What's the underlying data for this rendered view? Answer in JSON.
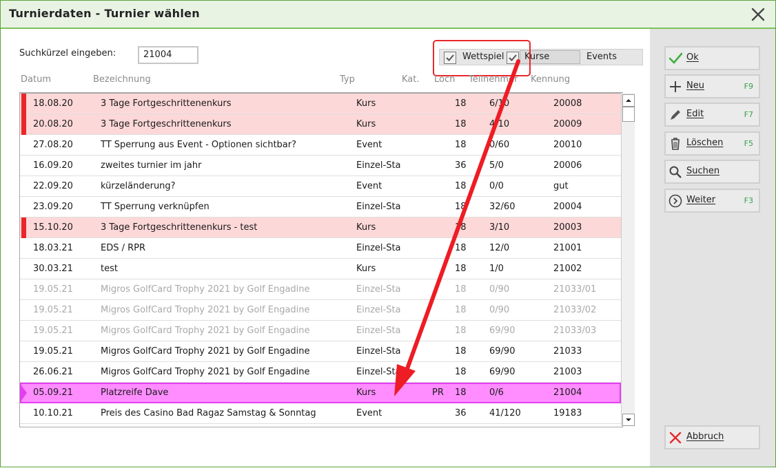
{
  "window": {
    "title": "Turnierdaten - Turnier wählen"
  },
  "search": {
    "label": "Suchkürzel eingeben:",
    "value": "21004"
  },
  "filters": [
    {
      "label": "Wettspiel",
      "checked": true
    },
    {
      "label": "Kurse",
      "checked": true
    },
    {
      "label": "Events",
      "checked": false
    }
  ],
  "columns": [
    "Datum",
    "Bezeichnung",
    "Typ",
    "Kat.",
    "Loch",
    "Teilnehmer",
    "Kennung"
  ],
  "rows": [
    {
      "datum": "18.08.20",
      "bezeichnung": "3 Tage Fortgeschrittenenkurs",
      "typ": "Kurs",
      "kat": "",
      "loch": "18",
      "teilnehmer": "6/10",
      "kennung": "20008",
      "style": "pink"
    },
    {
      "datum": "20.08.20",
      "bezeichnung": "3 Tage Fortgeschrittenenkurs",
      "typ": "Kurs",
      "kat": "",
      "loch": "18",
      "teilnehmer": "4/10",
      "kennung": "20009",
      "style": "pink"
    },
    {
      "datum": "27.08.20",
      "bezeichnung": "TT Sperrung aus Event - Optionen sichtbar?",
      "typ": "Event",
      "kat": "",
      "loch": "18",
      "teilnehmer": "0/60",
      "kennung": "20010",
      "style": "normal"
    },
    {
      "datum": "16.09.20",
      "bezeichnung": "zweites turnier im jahr",
      "typ": "Einzel-Sta",
      "kat": "",
      "loch": "36",
      "teilnehmer": "5/0",
      "kennung": "20006",
      "style": "normal"
    },
    {
      "datum": "22.09.20",
      "bezeichnung": "kürzeländerung?",
      "typ": "Event",
      "kat": "",
      "loch": "18",
      "teilnehmer": "0/0",
      "kennung": "gut",
      "style": "normal"
    },
    {
      "datum": "23.09.20",
      "bezeichnung": "TT Sperrung verknüpfen",
      "typ": "Einzel-Sta",
      "kat": "",
      "loch": "18",
      "teilnehmer": "32/60",
      "kennung": "20004",
      "style": "normal"
    },
    {
      "datum": "15.10.20",
      "bezeichnung": "3 Tage Fortgeschrittenenkurs - test",
      "typ": "Kurs",
      "kat": "",
      "loch": "18",
      "teilnehmer": "3/10",
      "kennung": "20003",
      "style": "pink"
    },
    {
      "datum": "18.03.21",
      "bezeichnung": "EDS / RPR",
      "typ": "Einzel-Sta",
      "kat": "",
      "loch": "18",
      "teilnehmer": "12/0",
      "kennung": "21001",
      "style": "normal"
    },
    {
      "datum": "30.03.21",
      "bezeichnung": "test",
      "typ": "Kurs",
      "kat": "",
      "loch": "18",
      "teilnehmer": "1/0",
      "kennung": "21002",
      "style": "normal"
    },
    {
      "datum": "19.05.21",
      "bezeichnung": "Migros GolfCard Trophy 2021 by Golf Engadine",
      "typ": "Einzel-Sta",
      "kat": "",
      "loch": "18",
      "teilnehmer": "0/90",
      "kennung": "21033/01",
      "style": "grey"
    },
    {
      "datum": "19.05.21",
      "bezeichnung": "Migros GolfCard Trophy 2021 by Golf Engadine",
      "typ": "Einzel-Sta",
      "kat": "",
      "loch": "18",
      "teilnehmer": "0/90",
      "kennung": "21033/02",
      "style": "grey"
    },
    {
      "datum": "19.05.21",
      "bezeichnung": "Migros GolfCard Trophy 2021 by Golf Engadine",
      "typ": "Einzel-Sta",
      "kat": "",
      "loch": "18",
      "teilnehmer": "69/90",
      "kennung": "21033/03",
      "style": "grey"
    },
    {
      "datum": "19.05.21",
      "bezeichnung": "Migros GolfCard Trophy 2021 by Golf Engadine",
      "typ": "Einzel-Sta",
      "kat": "",
      "loch": "18",
      "teilnehmer": "69/90",
      "kennung": "21033",
      "style": "normal"
    },
    {
      "datum": "26.06.21",
      "bezeichnung": "Migros GolfCard Trophy 2021 by Golf Engadine",
      "typ": "Einzel-Sta",
      "kat": "",
      "loch": "18",
      "teilnehmer": "69/90",
      "kennung": "21003",
      "style": "normal"
    },
    {
      "datum": "05.09.21",
      "bezeichnung": "Platzreife Dave",
      "typ": "Kurs",
      "kat": "PR",
      "loch": "18",
      "teilnehmer": "0/6",
      "kennung": "21004",
      "style": "magenta"
    },
    {
      "datum": "10.10.21",
      "bezeichnung": "Preis des Casino Bad Ragaz  Samstag & Sonntag",
      "typ": "Event",
      "kat": "",
      "loch": "36",
      "teilnehmer": "41/120",
      "kennung": "19183",
      "style": "normal"
    }
  ],
  "buttons": [
    {
      "id": "ok",
      "label": "Ok",
      "key": "",
      "icon": "check-icon"
    },
    {
      "id": "neu",
      "label": "Neu",
      "key": "F9",
      "icon": "plus-icon"
    },
    {
      "id": "edit",
      "label": "Edit",
      "key": "F7",
      "icon": "pencil-icon"
    },
    {
      "id": "loeschen",
      "label": "Löschen",
      "key": "F5",
      "icon": "trash-icon"
    },
    {
      "id": "suchen",
      "label": "Suchen",
      "key": "",
      "icon": "magnifier-icon"
    },
    {
      "id": "weiter",
      "label": "Weiter",
      "key": "F3",
      "icon": "circle-chevron-right-icon"
    },
    {
      "id": "abbruch",
      "label": "Abbruch",
      "key": "",
      "icon": "red-x-icon"
    }
  ],
  "colors": {
    "accent_green": "#5aa53a",
    "pink_row": "#fdd8d8",
    "selected_row": "#ff8dff",
    "annotation_red": "#e8272a"
  }
}
